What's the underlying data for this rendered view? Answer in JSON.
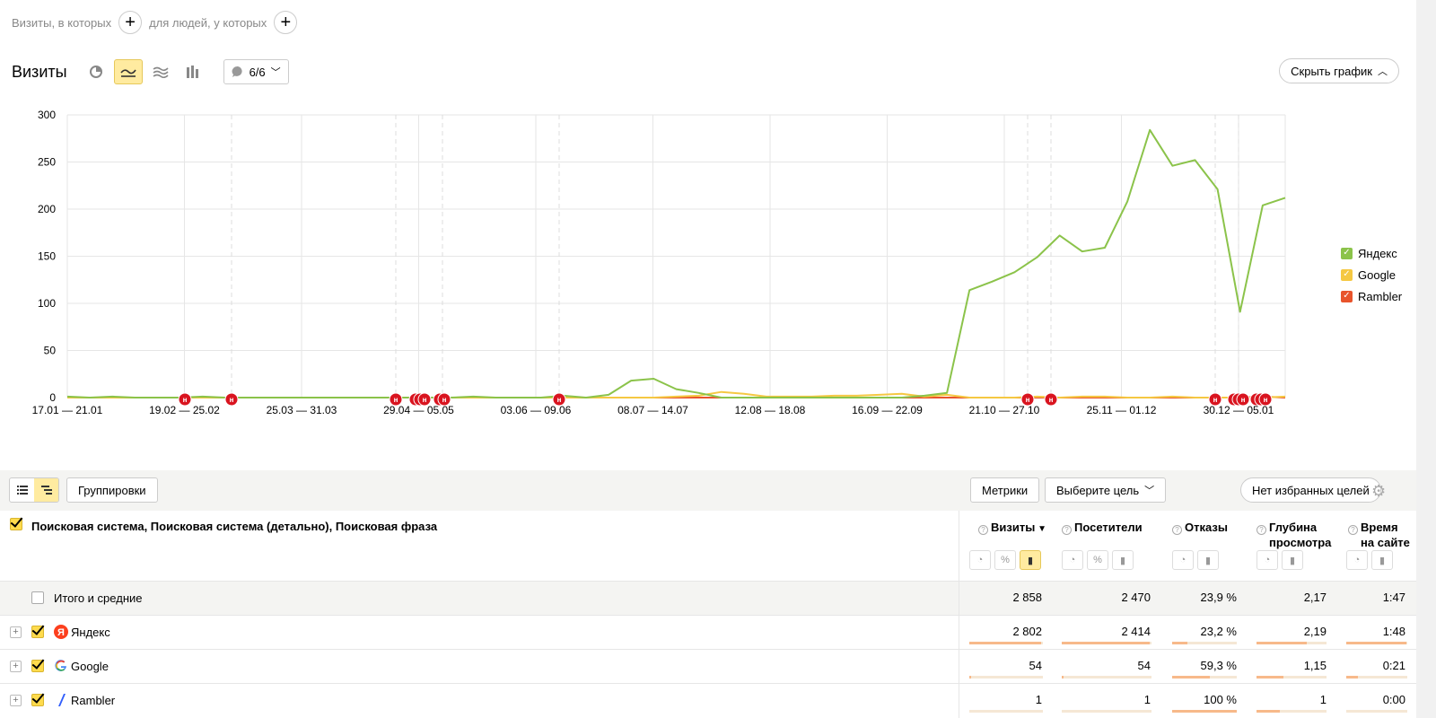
{
  "filters": {
    "visits_label": "Визиты, в которых",
    "people_label": "для людей, у которых"
  },
  "header": {
    "title": "Визиты",
    "annotations_count": "6/6",
    "hide_chart": "Скрыть график"
  },
  "chart_data": {
    "type": "line",
    "ylim": [
      0,
      300
    ],
    "yticks": [
      0,
      50,
      100,
      150,
      200,
      250,
      300
    ],
    "x_tick_labels": [
      "17.01 — 21.01",
      "19.02 — 25.02",
      "25.03 — 31.03",
      "29.04 — 05.05",
      "03.06 — 09.06",
      "08.07 — 14.07",
      "12.08 — 18.08",
      "16.09 — 22.09",
      "21.10 — 27.10",
      "25.11 — 01.12",
      "30.12 — 05.01"
    ],
    "series": [
      {
        "name": "Яндекс",
        "color": "#8bc34a",
        "values": [
          1,
          0,
          1,
          0,
          0,
          0,
          1,
          0,
          0,
          0,
          0,
          0,
          0,
          0,
          0,
          0,
          0,
          0,
          1,
          0,
          0,
          0,
          2,
          0,
          3,
          18,
          20,
          9,
          5,
          0,
          0,
          0,
          0,
          0,
          0,
          0,
          0,
          0,
          2,
          5,
          114,
          123,
          133,
          149,
          172,
          155,
          159,
          208,
          284,
          246,
          252,
          221,
          91,
          204,
          212
        ]
      },
      {
        "name": "Google",
        "color": "#f5c842",
        "values": [
          0,
          0,
          0,
          0,
          0,
          0,
          0,
          0,
          0,
          0,
          0,
          0,
          0,
          0,
          0,
          0,
          0,
          0,
          0,
          0,
          0,
          0,
          0,
          0,
          0,
          0,
          0,
          1,
          2,
          6,
          4,
          1,
          1,
          1,
          2,
          2,
          3,
          4,
          1,
          3,
          0,
          0,
          0,
          1,
          0,
          1,
          1,
          0,
          0,
          1,
          0,
          0,
          0,
          0,
          1
        ]
      },
      {
        "name": "Rambler",
        "color": "#e8542c",
        "values": [
          0,
          0,
          0,
          0,
          0,
          0,
          0,
          0,
          0,
          0,
          0,
          0,
          0,
          0,
          0,
          0,
          0,
          0,
          0,
          0,
          0,
          0,
          0,
          0,
          0,
          0,
          0,
          0,
          0,
          0,
          0,
          0,
          0,
          0,
          0,
          0,
          0,
          0,
          0,
          0,
          0,
          0,
          0,
          0,
          0,
          0,
          0,
          0,
          0,
          0,
          0,
          0,
          0,
          1,
          0
        ]
      }
    ],
    "annotation_marker": "н"
  },
  "toolbar": {
    "groupings": "Группировки",
    "metrics": "Метрики",
    "select_goal": "Выберите цель",
    "no_fav_goals": "Нет избранных целей"
  },
  "table": {
    "dimension_header": "Поисковая система, Поисковая система (детально), Поисковая фраза",
    "columns": [
      {
        "line1": "Визиты",
        "line2": "",
        "sort": "▼"
      },
      {
        "line1": "Посетители",
        "line2": ""
      },
      {
        "line1": "Отказы",
        "line2": ""
      },
      {
        "line1": "Глубина",
        "line2": "просмотра"
      },
      {
        "line1": "Время",
        "line2": "на сайте"
      }
    ],
    "total": {
      "label": "Итого и средние",
      "values": [
        "2 858",
        "2 470",
        "23,9 %",
        "2,17",
        "1:47"
      ]
    },
    "rows": [
      {
        "label": "Яндекс",
        "values": [
          "2 802",
          "2 414",
          "23,2 %",
          "2,19",
          "1:48"
        ],
        "fills": [
          0.98,
          0.98,
          0.23,
          0.72,
          0.98
        ],
        "icon": "yandex-icon"
      },
      {
        "label": "Google",
        "values": [
          "54",
          "54",
          "59,3 %",
          "1,15",
          "0:21"
        ],
        "fills": [
          0.02,
          0.02,
          0.59,
          0.38,
          0.19
        ],
        "icon": "google-icon"
      },
      {
        "label": "Rambler",
        "values": [
          "1",
          "1",
          "100 %",
          "1",
          "0:00"
        ],
        "fills": [
          0.0,
          0.0,
          1.0,
          0.33,
          0.0
        ],
        "icon": "rambler-icon"
      }
    ]
  }
}
